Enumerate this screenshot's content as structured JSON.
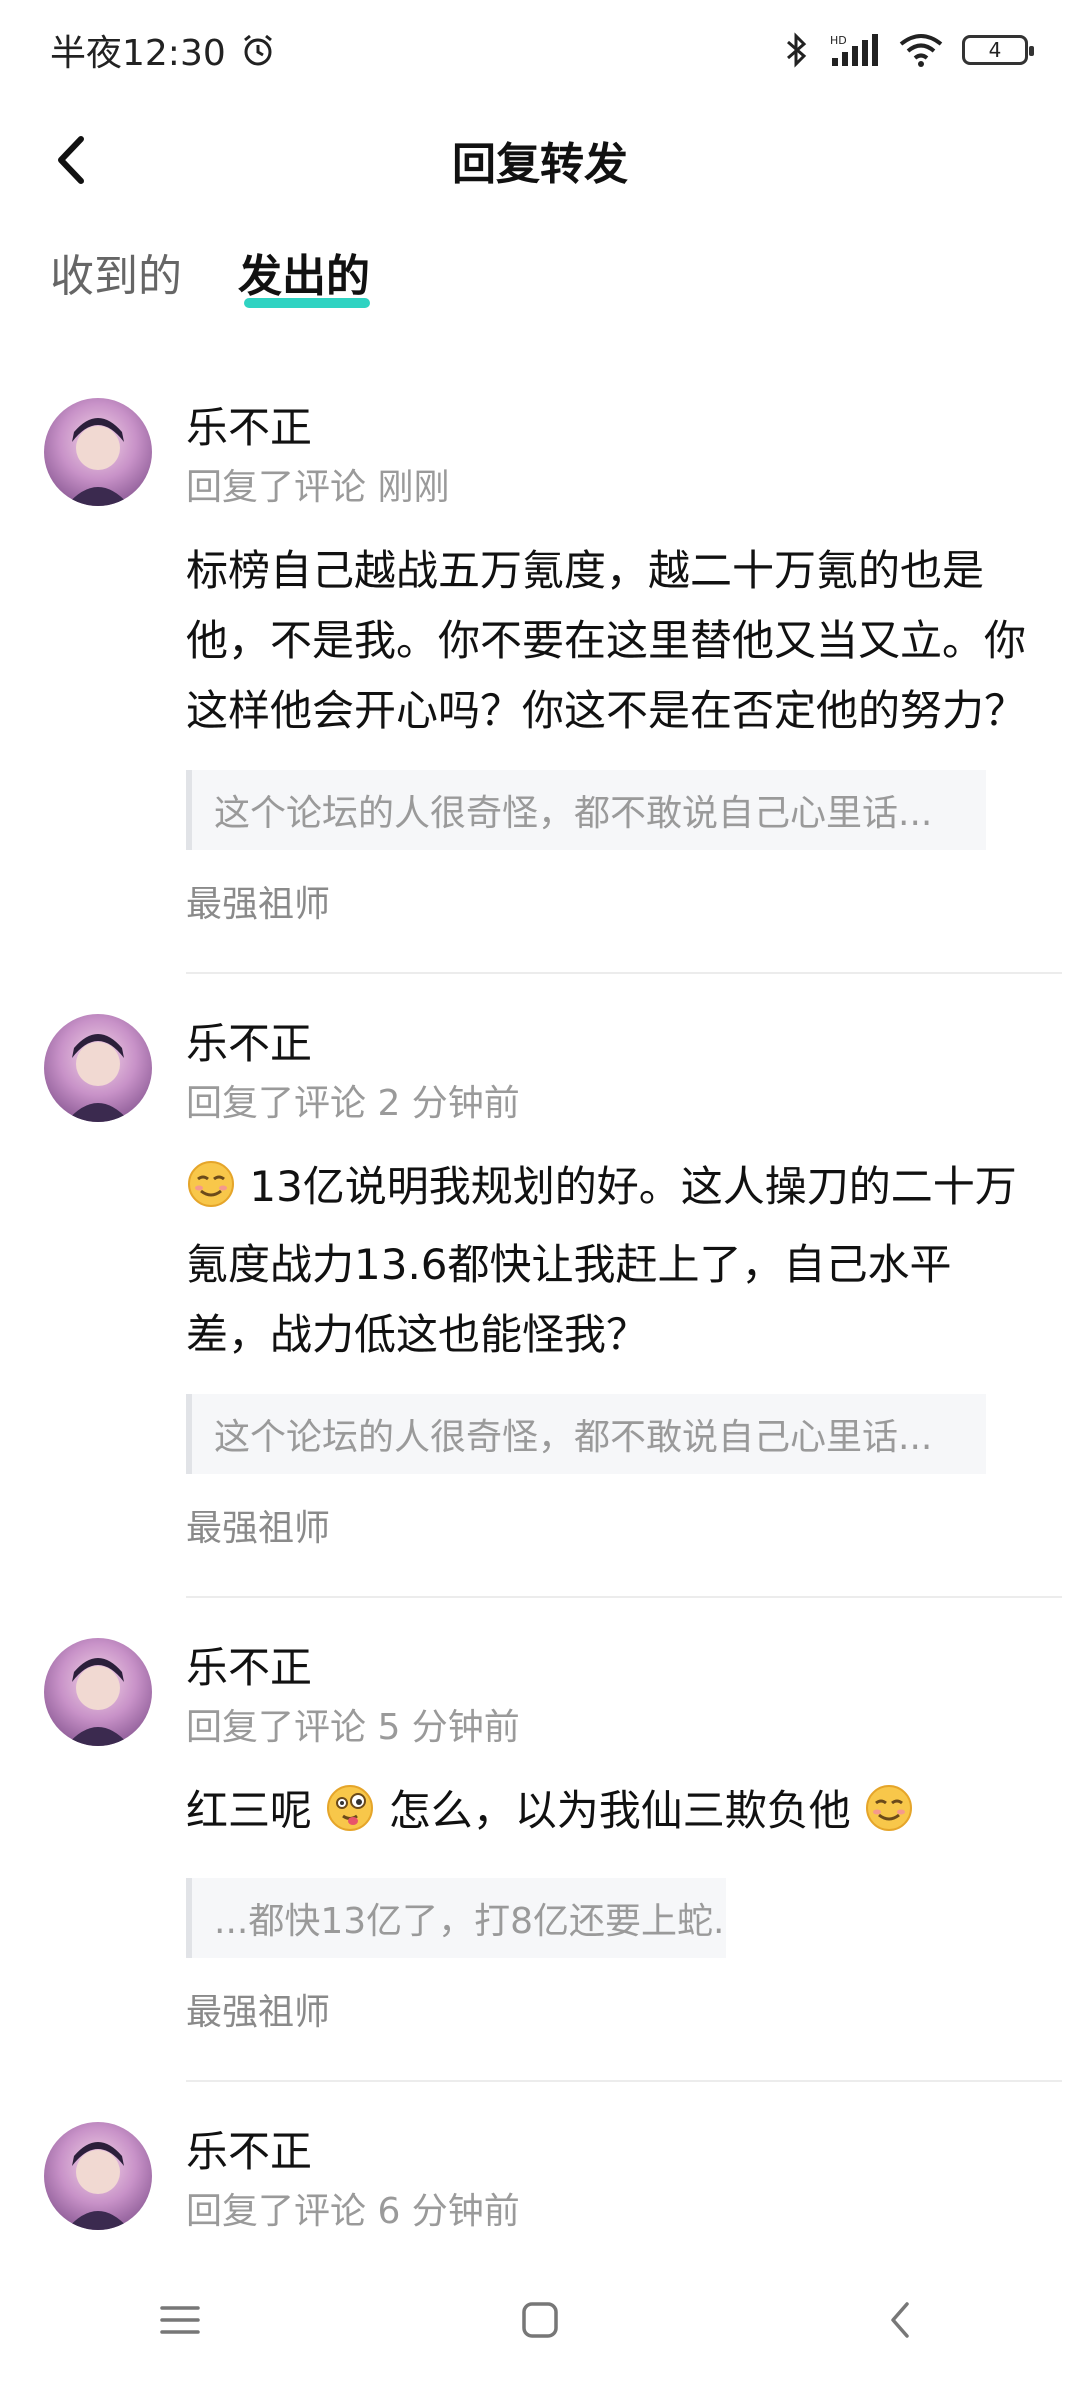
{
  "status_bar": {
    "time": "半夜12:30",
    "alarm_icon": "alarm-icon",
    "bluetooth_icon": "bluetooth-icon",
    "network_label": "HD",
    "wifi_icon": "wifi-icon",
    "battery_level": "4"
  },
  "header": {
    "title": "回复转发",
    "back_icon": "back-arrow-icon"
  },
  "tabs": [
    {
      "label": "收到的",
      "active": false
    },
    {
      "label": "发出的",
      "active": true
    }
  ],
  "accent_color": "#2fd3c2",
  "items": [
    {
      "name": "乐不正",
      "meta": "回复了评论 刚刚",
      "content": "标榜自己越战五万氪度，越二十万氪的也是他，不是我。你不要在这里替他又当又立。你这样他会开心吗？你这不是在否定他的努力？",
      "quote": "这个论坛的人很奇怪，都不敢说自己心里话...",
      "source": "最强祖师"
    },
    {
      "name": "乐不正",
      "meta": "回复了评论 2 分钟前",
      "content": "13亿说明我规划的好。这人操刀的二十万氪度战力13.6都快让我赶上了，自己水平差，战力低这也能怪我？",
      "quote": "这个论坛的人很奇怪，都不敢说自己心里话...",
      "source": "最强祖师"
    },
    {
      "name": "乐不正",
      "meta": "回复了评论 5 分钟前",
      "content_a": "红三呢",
      "content_b": " 怎么，以为我仙三欺负他",
      "quote": "...都快13亿了，打8亿还要上蛇......",
      "source": "最强祖师"
    },
    {
      "name": "乐不正",
      "meta": "回复了评论 6 分钟前"
    }
  ],
  "navbar": {
    "menu_icon": "menu-icon",
    "home_icon": "home-square-icon",
    "back_icon": "nav-back-icon"
  }
}
